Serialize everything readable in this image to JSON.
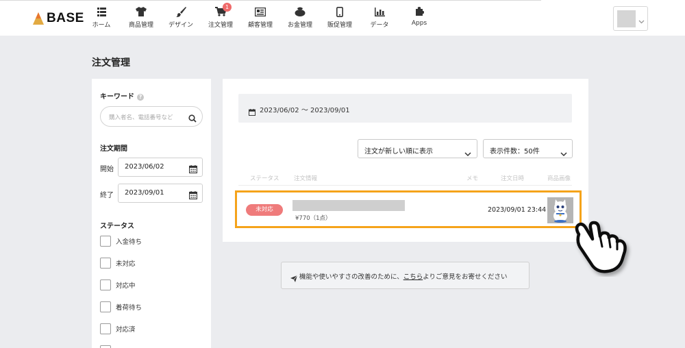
{
  "header": {
    "logo_text": "BASE",
    "nav": [
      {
        "label": "ホーム",
        "icon": "list-icon"
      },
      {
        "label": "商品管理",
        "icon": "tshirt-icon"
      },
      {
        "label": "デザイン",
        "icon": "brush-icon"
      },
      {
        "label": "注文管理",
        "icon": "cart-icon",
        "badge": "1"
      },
      {
        "label": "顧客管理",
        "icon": "address-card-icon"
      },
      {
        "label": "お金管理",
        "icon": "wallet-icon"
      },
      {
        "label": "販促管理",
        "icon": "phone-icon"
      },
      {
        "label": "データ",
        "icon": "bar-chart-icon"
      },
      {
        "label": "Apps",
        "icon": "puzzle-icon"
      }
    ]
  },
  "page": {
    "title": "注文管理"
  },
  "sidebar": {
    "keyword": {
      "label": "キーワード",
      "help": "?",
      "placeholder": "購入者名、電話番号など"
    },
    "period": {
      "label": "注文期間",
      "start_label": "開始",
      "start_value": "2023/06/02",
      "end_label": "終了",
      "end_value": "2023/09/01"
    },
    "status": {
      "label": "ステータス",
      "items": [
        "入金待ち",
        "未対応",
        "対応中",
        "着荷待ち",
        "対応済"
      ]
    }
  },
  "main": {
    "date_range": "2023/06/02 〜 2023/09/01",
    "sort_select": "注文が新しい順に表示",
    "count_select": "表示件数：50件",
    "columns": {
      "status": "ステータス",
      "info": "注文情報",
      "memo": "メモ",
      "date": "注文日時",
      "image": "商品画像"
    },
    "orders": [
      {
        "status": "未対応",
        "price": "¥770（1点）",
        "datetime": "2023/09/01 23:44"
      }
    ]
  },
  "feedback": {
    "prefix": "機能や使いやすさの改善のために、",
    "link": "こちら",
    "suffix": "よりご意見をお寄せください"
  },
  "colors": {
    "accent_orange": "#f5a31a",
    "badge_red": "#ef6a6a",
    "status_pill": "#ef7b7b"
  }
}
